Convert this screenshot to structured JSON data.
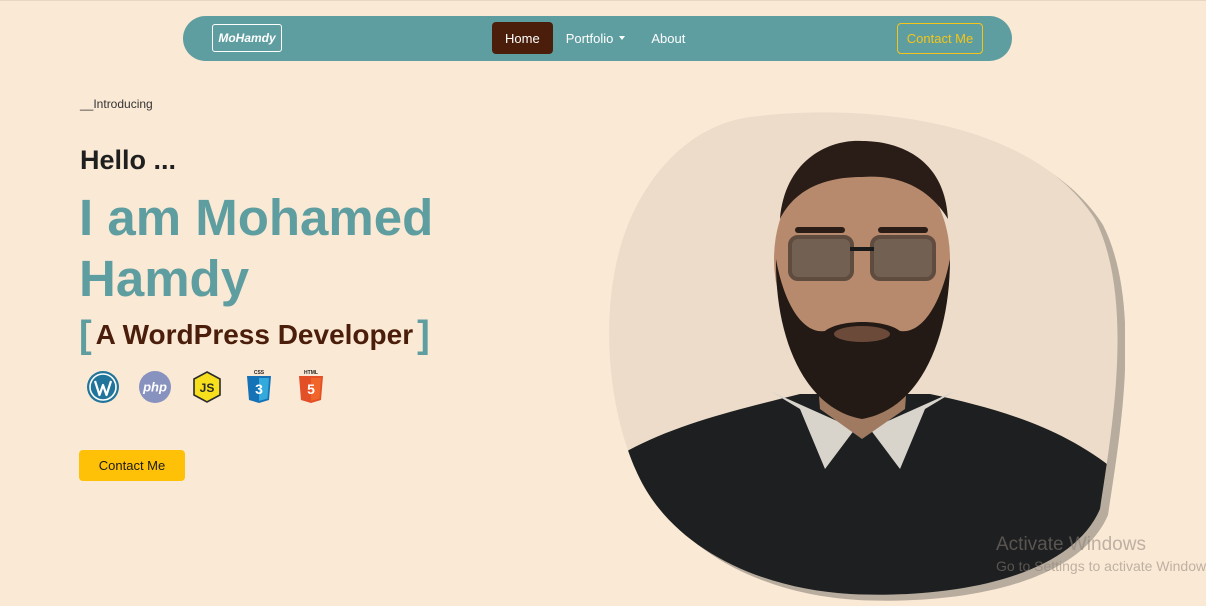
{
  "navbar": {
    "brand": "MoHamdy",
    "links": [
      {
        "label": "Home",
        "active": true
      },
      {
        "label": "Portfolio",
        "dropdown": true
      },
      {
        "label": "About"
      }
    ],
    "contact_label": "Contact Me",
    "bg_color": "#5f9ea0",
    "active_color": "#4a1e0a",
    "contact_color": "#f5c518"
  },
  "hero": {
    "intro": "__Introducing",
    "greeting": "Hello ...",
    "name": "I am Mohamed Hamdy",
    "role_open_bracket": "[",
    "role": "A WordPress Developer",
    "role_close_bracket": "]",
    "tech_icons": [
      "wordpress-icon",
      "php-icon",
      "javascript-icon",
      "css3-icon",
      "html5-icon"
    ],
    "cta_label": "Contact Me",
    "name_color": "#5f9ea0",
    "role_color": "#4a1e0a",
    "cta_color": "#ffc107"
  },
  "watermark": {
    "title": "Activate Windows",
    "subtitle": "Go to Settings to activate Windows."
  },
  "page": {
    "bg_color": "#fae9d5"
  }
}
